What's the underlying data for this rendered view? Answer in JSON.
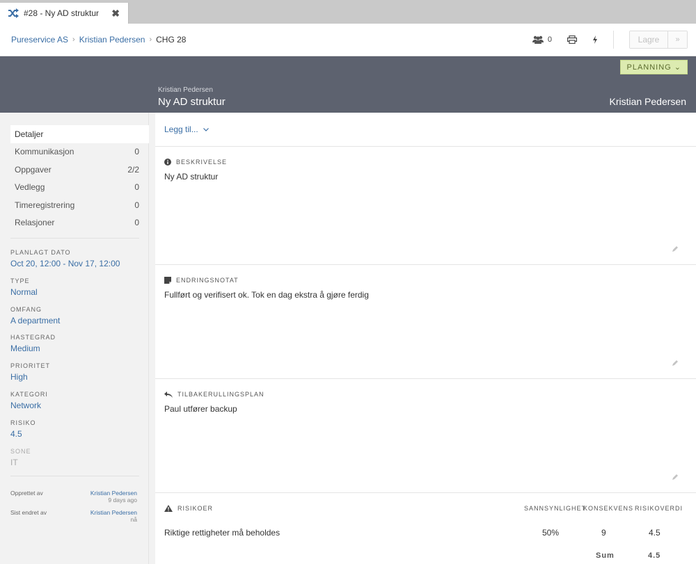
{
  "tab": {
    "title": "#28 - Ny AD struktur",
    "close": "✖"
  },
  "breadcrumb": {
    "items": [
      "Pureservice AS",
      "Kristian Pedersen"
    ],
    "current": "CHG 28",
    "separator": "›"
  },
  "toolbar": {
    "users_count": "0",
    "save_label": "Lagre",
    "more_label": "»"
  },
  "status": {
    "label": "PLANNING ⌄"
  },
  "hero": {
    "requester_small": "Kristian Pedersen",
    "title": "Ny AD struktur",
    "requester_right": "Kristian Pedersen"
  },
  "nav": {
    "items": [
      {
        "label": "Detaljer",
        "count": ""
      },
      {
        "label": "Kommunikasjon",
        "count": "0"
      },
      {
        "label": "Oppgaver",
        "count": "2/2"
      },
      {
        "label": "Vedlegg",
        "count": "0"
      },
      {
        "label": "Timeregistrering",
        "count": "0"
      },
      {
        "label": "Relasjoner",
        "count": "0"
      }
    ]
  },
  "fields": [
    {
      "label": "PLANLAGT DATO",
      "value": "Oct 20, 12:00 - Nov 17, 12:00"
    },
    {
      "label": "TYPE",
      "value": "Normal"
    },
    {
      "label": "OMFANG",
      "value": "A department"
    },
    {
      "label": "HASTEGRAD",
      "value": "Medium"
    },
    {
      "label": "PRIORITET",
      "value": "High"
    },
    {
      "label": "KATEGORI",
      "value": "Network"
    },
    {
      "label": "RISIKO",
      "value": "4.5"
    },
    {
      "label": "SONE",
      "value": "IT"
    }
  ],
  "meta": {
    "created_label": "Opprettet av",
    "created_by": "Kristian Pedersen",
    "created_time": "9 days ago",
    "modified_label": "Sist endret av",
    "modified_by": "Kristian Pedersen",
    "modified_time": "nå"
  },
  "main": {
    "add_label": "Legg til...",
    "sections": [
      {
        "heading": "BESKRIVELSE",
        "body": "Ny AD struktur"
      },
      {
        "heading": "ENDRINGSNOTAT",
        "body": "Fullført og verifisert ok. Tok en dag ekstra å gjøre ferdig"
      },
      {
        "heading": "TILBAKERULLINGSPLAN",
        "body": "Paul utfører backup"
      }
    ],
    "risks": {
      "heading": "RISIKOER",
      "columns": [
        "SANNSYNLIGHET",
        "KONSEKVENS",
        "RISIKOVERDI"
      ],
      "rows": [
        {
          "name": "Riktige rettigheter må beholdes",
          "probability": "50%",
          "consequence": "9",
          "value": "4.5"
        }
      ],
      "sum_label": "Sum",
      "sum_value": "4.5"
    }
  },
  "colors": {
    "accent": "#3a6ea5",
    "hero": "#5d626f",
    "status": "#dcebb0"
  }
}
